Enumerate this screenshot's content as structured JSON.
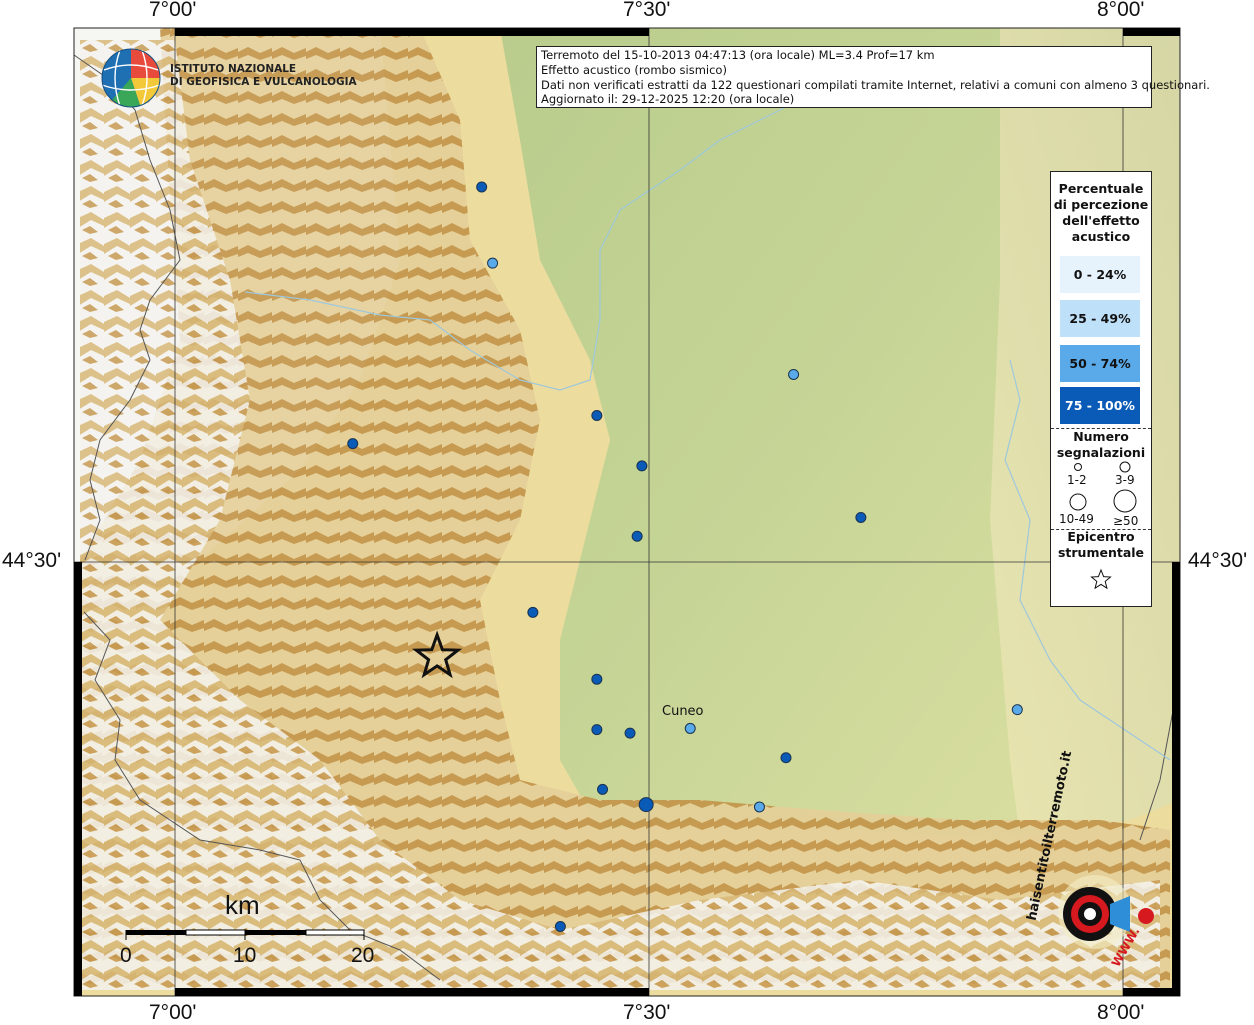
{
  "header": {
    "line1": "Terremoto del 15-10-2013 04:47:13 (ora locale) ML=3.4 Prof=17 km",
    "line2": "Effetto acustico (rombo sismico)",
    "line3": "Dati non verificati estratti da 122 questionari compilati tramite Internet, relativi a comuni con almeno 3 questionari.",
    "line4": "Aggiornato il: 29-12-2025 12:20 (ora locale)"
  },
  "institute": {
    "line1": "ISTITUTO NAZIONALE",
    "line2": "DI GEOFISICA E VULCANOLOGIA"
  },
  "axes": {
    "lon_ticks": [
      "7°00'",
      "7°30'",
      "8°00'"
    ],
    "lat_tick": "44°30'"
  },
  "legend": {
    "title_lines": [
      "Percentuale",
      "di percezione",
      "dell'effetto",
      "acustico"
    ],
    "classes": [
      {
        "label": "0 - 24%",
        "color": "#e6f3fd"
      },
      {
        "label": "25 - 49%",
        "color": "#bfe0f9"
      },
      {
        "label": "50 - 74%",
        "color": "#5aa9e8"
      },
      {
        "label": "75 - 100%",
        "color": "#0a5ab7",
        "text_color": "#ffffff"
      }
    ],
    "count_title_lines": [
      "Numero",
      "segnalazioni"
    ],
    "count_classes": [
      "1-2",
      "3-9",
      "10-49",
      "≥50"
    ],
    "epicenter_title_lines": [
      "Epicentro",
      "strumentale"
    ]
  },
  "city": "Cuneo",
  "scale": {
    "unit": "km",
    "labels": [
      "0",
      "10",
      "20"
    ]
  },
  "watermark": {
    "text": "haisentitoilterremoto.it",
    "www": "WWW."
  },
  "points": [
    {
      "lon": 7.3235,
      "lat": 44.82,
      "class": 3,
      "size": "small"
    },
    {
      "lon": 7.335,
      "lat": 44.755,
      "class": 2,
      "size": "small"
    },
    {
      "lon": 7.445,
      "lat": 44.625,
      "class": 3,
      "size": "small"
    },
    {
      "lon": 7.4925,
      "lat": 44.582,
      "class": 3,
      "size": "small"
    },
    {
      "lon": 7.1875,
      "lat": 44.601,
      "class": 3,
      "size": "small"
    },
    {
      "lon": 7.6525,
      "lat": 44.66,
      "class": 2,
      "size": "small"
    },
    {
      "lon": 7.7235,
      "lat": 44.538,
      "class": 3,
      "size": "small"
    },
    {
      "lon": 7.4875,
      "lat": 44.522,
      "class": 3,
      "size": "small"
    },
    {
      "lon": 7.3775,
      "lat": 44.457,
      "class": 3,
      "size": "small"
    },
    {
      "lon": 7.445,
      "lat": 44.4,
      "class": 3,
      "size": "small"
    },
    {
      "lon": 7.445,
      "lat": 44.357,
      "class": 3,
      "size": "small"
    },
    {
      "lon": 7.48,
      "lat": 44.354,
      "class": 3,
      "size": "small"
    },
    {
      "lon": 7.5435,
      "lat": 44.358,
      "class": 2,
      "size": "small"
    },
    {
      "lon": 7.8885,
      "lat": 44.374,
      "class": 2,
      "size": "small"
    },
    {
      "lon": 7.6445,
      "lat": 44.333,
      "class": 3,
      "size": "small"
    },
    {
      "lon": 7.451,
      "lat": 44.306,
      "class": 3,
      "size": "small"
    },
    {
      "lon": 7.497,
      "lat": 44.293,
      "class": 3,
      "size": "medium"
    },
    {
      "lon": 7.6165,
      "lat": 44.291,
      "class": 2,
      "size": "small"
    },
    {
      "lon": 7.4065,
      "lat": 44.189,
      "class": 3,
      "size": "small"
    }
  ],
  "epicenter": {
    "lon": 7.2765,
    "lat": 44.419
  }
}
